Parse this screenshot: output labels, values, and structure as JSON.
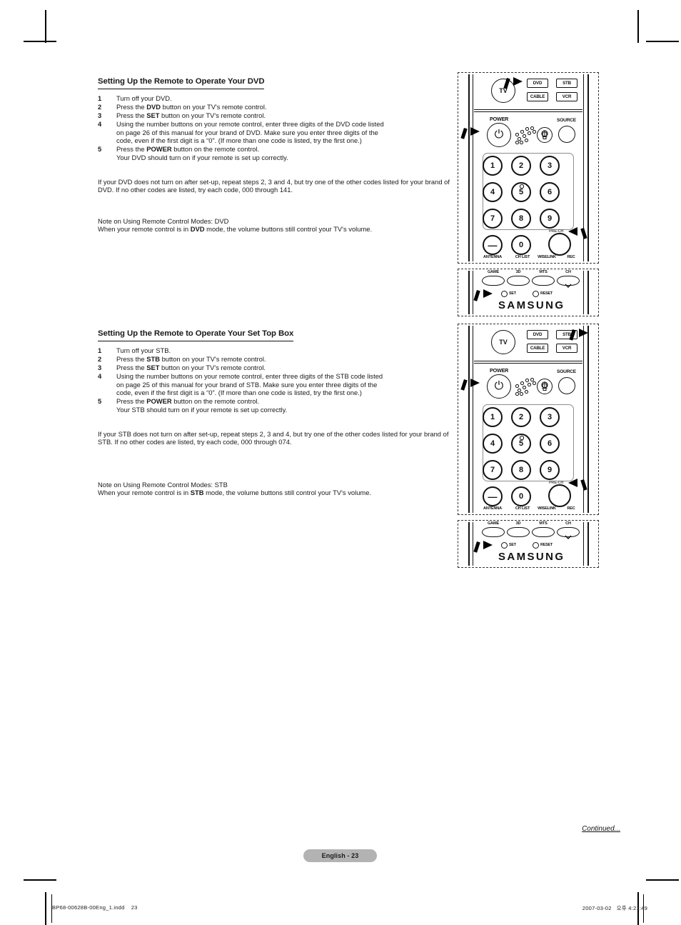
{
  "document": {
    "sections": [
      {
        "id": "dvd",
        "heading": "Setting Up the Remote to Operate Your DVD",
        "steps": [
          {
            "num": "1",
            "lines": [
              {
                "text": "Turn off your DVD."
              }
            ]
          },
          {
            "num": "2",
            "lines": [
              {
                "pre": "Press the ",
                "bold": "DVD",
                "post": " button on your TV's remote control."
              }
            ]
          },
          {
            "num": "3",
            "lines": [
              {
                "pre": "Press the ",
                "bold": "SET",
                "post": " button on your TV's remote control."
              }
            ]
          },
          {
            "num": "4",
            "lines": [
              {
                "text": "Using the number buttons on your remote control, enter three digits of the DVD code listed"
              },
              {
                "text": "on page 26 of this manual for your brand of DVD. Make sure you enter three digits of the"
              },
              {
                "text": "code, even if the first digit is a “0”. (If more than one code is listed, try the first one.)"
              }
            ]
          },
          {
            "num": "5",
            "lines": [
              {
                "pre": "Press the ",
                "bold": "POWER",
                "post": " button on the remote control."
              },
              {
                "text": "Your DVD should turn on if your remote is set up correctly."
              }
            ]
          }
        ],
        "paragraph": "If your DVD does not turn on after set-up, repeat steps 2, 3 and 4, but try one of the other codes listed for your brand of DVD. If no other codes are listed, try each code, 000 through 141.",
        "note_title": "Note on Using Remote Control Modes: DVD",
        "note_pre": "When your remote control is in ",
        "note_bold": "DVD",
        "note_post": " mode, the volume buttons still control your TV's volume."
      },
      {
        "id": "stb",
        "heading": "Setting Up the Remote to Operate Your Set Top Box",
        "steps": [
          {
            "num": "1",
            "lines": [
              {
                "text": "Turn off your STB."
              }
            ]
          },
          {
            "num": "2",
            "lines": [
              {
                "pre": "Press the ",
                "bold": "STB",
                "post": " button on your TV's remote control."
              }
            ]
          },
          {
            "num": "3",
            "lines": [
              {
                "pre": "Press the ",
                "bold": "SET",
                "post": " button on your TV's remote control."
              }
            ]
          },
          {
            "num": "4",
            "lines": [
              {
                "text": "Using the number buttons on your remote control, enter three digits of the STB code listed"
              },
              {
                "text": "on page 25 of this manual for your brand of STB. Make sure you enter three digits of the"
              },
              {
                "text": "code, even if the first digit is a “0”. (If more than one code is listed, try the first one.)"
              }
            ]
          },
          {
            "num": "5",
            "lines": [
              {
                "pre": "Press the ",
                "bold": "POWER",
                "post": " button on the remote control."
              },
              {
                "text": "Your STB should turn on if your remote is set up correctly."
              }
            ]
          }
        ],
        "paragraph": "If your STB does not turn on after set-up, repeat steps 2, 3 and 4, but try one of the other codes listed for your brand of STB. If no other codes are listed, try each code, 000 through 074.",
        "note_title": "Note on Using Remote Control Modes: STB",
        "note_pre": "When your remote control is in ",
        "note_bold": "STB",
        "note_post": " mode, the volume buttons still control your TV's volume."
      }
    ]
  },
  "remote": {
    "mode_buttons": {
      "tv": "TV",
      "dvd": "DVD",
      "stb": "STB",
      "cable": "CABLE",
      "vcr": "VCR"
    },
    "power_label": "POWER",
    "source_label": "SOURCE",
    "keypad": [
      "1",
      "2",
      "3",
      "4",
      "5",
      "6",
      "7",
      "8",
      "9",
      "0"
    ],
    "minus_label": "—",
    "prech_label": "PRE-CH",
    "bottom_labels": [
      "ANTENNA",
      "CH LIST",
      "WISELINK",
      "REC"
    ],
    "lower_panel_labels": [
      "GAME",
      "3D",
      "MTS",
      "CH"
    ],
    "set_label": "SET",
    "reset_label": "RESET",
    "brand": "SAMSUNG"
  },
  "illustrations": [
    {
      "id": "dvd-remote",
      "highlight": "DVD"
    },
    {
      "id": "stb-remote",
      "highlight": "STB"
    }
  ],
  "footer": {
    "continued": "Continued...",
    "page_badge": "English - 23",
    "print_file": "BP68-00628B-00Eng_1.indd    23",
    "print_timestamp": "2007-03-02   오후 4:21:49"
  },
  "colors": {
    "text": "#1a1a1a",
    "badge_bg": "#b3b3b3",
    "rule": "#111111"
  }
}
